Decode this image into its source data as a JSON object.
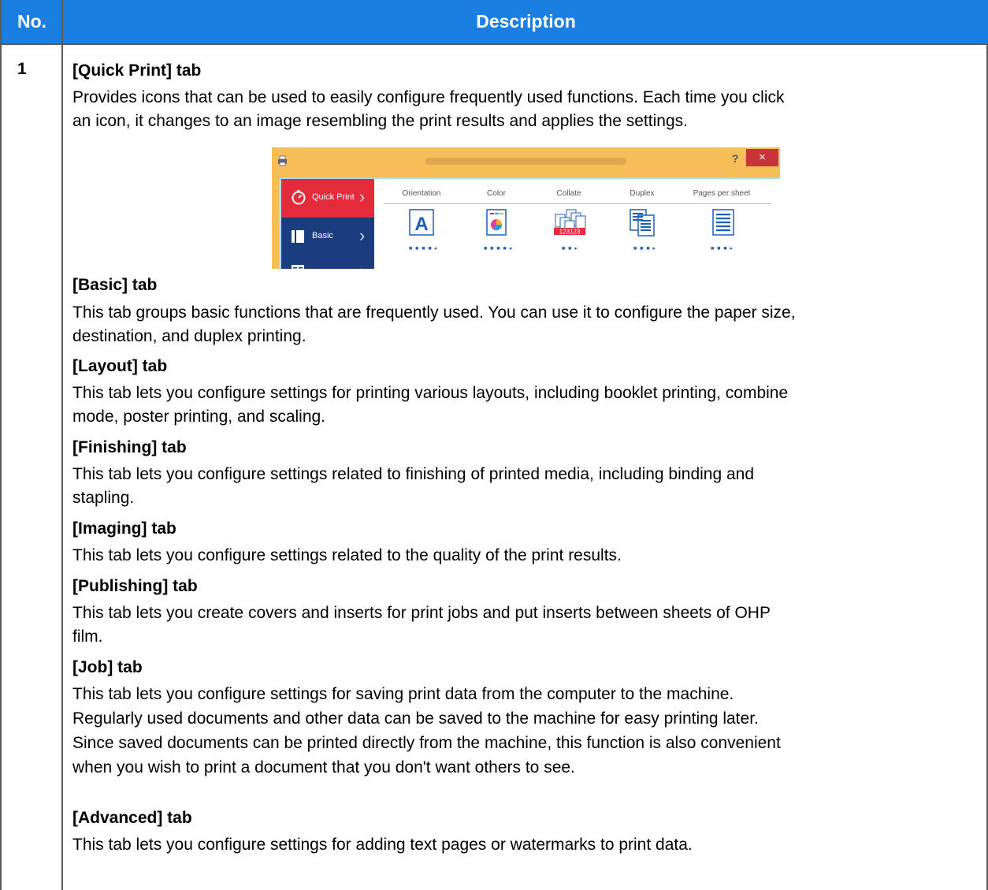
{
  "header": {
    "col_no": "No.",
    "col_description": "Description"
  },
  "row": {
    "number": "1"
  },
  "entries": [
    {
      "heading": "[Quick Print] tab",
      "lines": [
        "Provides icons that can be used to easily configure frequently used functions. Each time you click",
        "an icon, it changes to an image resembling the print results and applies the settings."
      ]
    },
    {
      "heading": "[Basic] tab",
      "lines": [
        "This tab groups basic functions that are frequently used. You can use it to configure the paper size,",
        "destination, and duplex printing."
      ]
    },
    {
      "heading": "[Layout] tab",
      "lines": [
        "This tab lets you configure settings for printing various layouts, including booklet printing, combine",
        "mode, poster printing, and scaling."
      ]
    },
    {
      "heading": "[Finishing] tab",
      "lines": [
        "This tab lets you configure settings related to finishing of printed media, including binding and",
        "stapling."
      ]
    },
    {
      "heading": "[Imaging] tab",
      "lines": [
        "This tab lets you configure settings related to the quality of the print results."
      ]
    },
    {
      "heading": "[Publishing] tab",
      "lines": [
        "This tab lets you create covers and inserts for print jobs and put inserts between sheets of OHP",
        "film."
      ]
    },
    {
      "heading": "[Job] tab",
      "lines": [
        "This tab lets you configure settings for saving print data from the computer to the machine.",
        "Regularly used documents and other data can be saved to the machine for easy printing later.",
        "Since saved documents can be printed directly from the machine, this function is also convenient",
        "when you wish to print a document that you don't want others to see."
      ]
    },
    {
      "heading": "[Advanced] tab",
      "lines": [
        "This tab lets you configure settings for adding text pages or watermarks to print data."
      ]
    }
  ],
  "dialog": {
    "help_label": "?",
    "close_label": "×",
    "sidebar_tabs": [
      {
        "label": "Quick Print",
        "icon": "stopwatch-icon"
      },
      {
        "label": "Basic",
        "icon": "page-icon"
      },
      {
        "label": "",
        "icon": "layout-icon"
      }
    ],
    "columns": [
      "Orientation",
      "Color",
      "Collate",
      "Duplex",
      "Pages per sheet"
    ],
    "orientation_letter": "A",
    "collate_badge": "123123",
    "colors": {
      "header_blue": "#1a7fe0",
      "title_orange": "#f6bd58",
      "close_red": "#c9333a",
      "sidebar_navy": "#1b3d7f",
      "active_tab_red": "#e32b3c",
      "pane_blue": "#a9dcf2"
    }
  }
}
